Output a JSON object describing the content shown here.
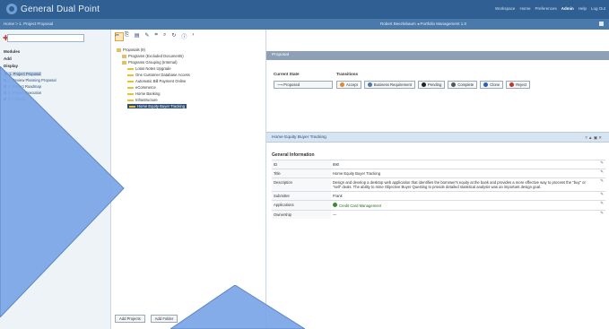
{
  "topbar": {
    "app_title": "General Dual Point",
    "nav": [
      "Workspace",
      "Home",
      "Preferences",
      "Admin",
      "Help",
      "Log Out"
    ],
    "active_nav_index": 3
  },
  "subbar": {
    "breadcrumb": "Home > 1. Project Proposal",
    "user": "Robert Beezlebaum ◂ Portfolio Management 1.0"
  },
  "sidebar": {
    "sections": {
      "modules": "Modules",
      "add": "Add",
      "display": "Display"
    },
    "items": [
      {
        "label": "1. Project Proposal",
        "selected": true
      },
      {
        "label": "2. Review Planning Proposal",
        "selected": false
      },
      {
        "label": "3. Project Roadmap",
        "selected": false
      },
      {
        "label": "4. Project Execution",
        "selected": false
      },
      {
        "label": "5. Closure",
        "selected": false
      }
    ]
  },
  "tree": {
    "nodes": [
      {
        "label": "Proposals (9)",
        "type": "root"
      },
      {
        "label": "Programs (Excluded Documents)",
        "type": "folder"
      },
      {
        "label": "Programs Grouping (Internal)",
        "type": "folder"
      },
      {
        "label": "Lotus Notes Upgrade",
        "type": "project"
      },
      {
        "label": "One Customer Database Access",
        "type": "project"
      },
      {
        "label": "Automatic Bill Payment Online",
        "type": "project"
      },
      {
        "label": "eCommerce",
        "type": "project"
      },
      {
        "label": "Home Banking",
        "type": "project"
      },
      {
        "label": "Infrastructure",
        "type": "project"
      },
      {
        "label": "Home Equity Buyer Tracking",
        "type": "project",
        "selected": true
      }
    ],
    "footer_buttons": [
      "Add Projects",
      "Add Folder"
    ]
  },
  "main": {
    "header": "Proposal",
    "current_state_label": "Current State",
    "transitions_label": "Transitions",
    "current_state": "Proposed",
    "transitions": [
      {
        "label": "Accept",
        "color": "#e08a2c"
      },
      {
        "label": "Business Requirement",
        "color": "#4a7aac"
      },
      {
        "label": "Pending",
        "color": "#222222"
      },
      {
        "label": "Complete",
        "color": "#555555"
      },
      {
        "label": "Clone",
        "color": "#2a5fb0"
      },
      {
        "label": "Reject",
        "color": "#c0392b"
      }
    ],
    "band_title": "Home Equity Buyer Tracking",
    "band_controls": "? ▲ ▣ ✕",
    "general_info_title": "General Information",
    "fields": [
      {
        "key": "ID",
        "value": "890"
      },
      {
        "key": "Title",
        "value": "Home Equity Buyer Tracking"
      },
      {
        "key": "Description",
        "value": "Design and develop a desktop web application that identifies the borrower's equity at the bank and provides a more effective way to process the \"buy\" or \"sell\" deals. The ability to mine Objective Buyer Questing to provide detailed statistical analysis was an important design goal."
      },
      {
        "key": "Submitter",
        "value": "Frank"
      },
      {
        "key": "Applications",
        "value": "Credit Card Management",
        "link": true
      },
      {
        "key": "Ownership",
        "value": "—"
      }
    ]
  },
  "colors": {
    "topbar": "#2f5f93",
    "subbar": "#4a7aac",
    "overlay_shape": "#7aa5e6"
  }
}
